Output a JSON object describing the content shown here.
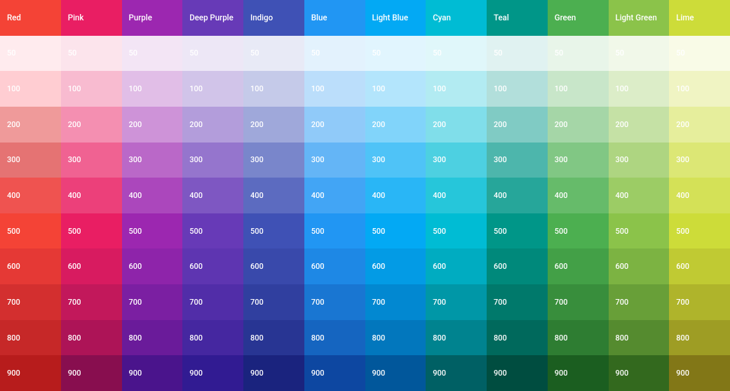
{
  "colors": [
    {
      "name": "Red",
      "swatches": {
        "header": "#f44336",
        "50": "#ffebee",
        "100": "#ffcdd2",
        "200": "#ef9a9a",
        "300": "#e57373",
        "400": "#ef5350",
        "500": "#f44336",
        "600": "#e53935",
        "700": "#d32f2f",
        "800": "#c62828",
        "900": "#b71c1c"
      }
    },
    {
      "name": "Pink",
      "swatches": {
        "header": "#e91e63",
        "50": "#fce4ec",
        "100": "#f8bbd0",
        "200": "#f48fb1",
        "300": "#f06292",
        "400": "#ec407a",
        "500": "#e91e63",
        "600": "#d81b60",
        "700": "#c2185b",
        "800": "#ad1457",
        "900": "#880e4f"
      }
    },
    {
      "name": "Purple",
      "swatches": {
        "header": "#9c27b0",
        "50": "#f3e5f5",
        "100": "#e1bee7",
        "200": "#ce93d8",
        "300": "#ba68c8",
        "400": "#ab47bc",
        "500": "#9c27b0",
        "600": "#8e24aa",
        "700": "#7b1fa2",
        "800": "#6a1b9a",
        "900": "#4a148c"
      }
    },
    {
      "name": "Deep Purple",
      "swatches": {
        "header": "#673ab7",
        "50": "#ede7f6",
        "100": "#d1c4e9",
        "200": "#b39ddb",
        "300": "#9575cd",
        "400": "#7e57c2",
        "500": "#673ab7",
        "600": "#5e35b1",
        "700": "#512da8",
        "800": "#4527a0",
        "900": "#311b92"
      }
    },
    {
      "name": "Indigo",
      "swatches": {
        "header": "#3f51b5",
        "50": "#e8eaf6",
        "100": "#c5cae9",
        "200": "#9fa8da",
        "300": "#7986cb",
        "400": "#5c6bc0",
        "500": "#3f51b5",
        "600": "#3949ab",
        "700": "#303f9f",
        "800": "#283593",
        "900": "#1a237e"
      }
    },
    {
      "name": "Blue",
      "swatches": {
        "header": "#2196f3",
        "50": "#e3f2fd",
        "100": "#bbdefb",
        "200": "#90caf9",
        "300": "#64b5f6",
        "400": "#42a5f5",
        "500": "#2196f3",
        "600": "#1e88e5",
        "700": "#1976d2",
        "800": "#1565c0",
        "900": "#0d47a1"
      }
    },
    {
      "name": "Light Blue",
      "swatches": {
        "header": "#03a9f4",
        "50": "#e1f5fe",
        "100": "#b3e5fc",
        "200": "#81d4fa",
        "300": "#4fc3f7",
        "400": "#29b6f6",
        "500": "#03a9f4",
        "600": "#039be5",
        "700": "#0288d1",
        "800": "#0277bd",
        "900": "#01579b"
      }
    },
    {
      "name": "Cyan",
      "swatches": {
        "header": "#00bcd4",
        "50": "#e0f7fa",
        "100": "#b2ebf2",
        "200": "#80deea",
        "300": "#4dd0e1",
        "400": "#26c6da",
        "500": "#00bcd4",
        "600": "#00acc1",
        "700": "#0097a7",
        "800": "#00838f",
        "900": "#006064"
      }
    },
    {
      "name": "Teal",
      "swatches": {
        "header": "#009688",
        "50": "#e0f2f1",
        "100": "#b2dfdb",
        "200": "#80cbc4",
        "300": "#4db6ac",
        "400": "#26a69a",
        "500": "#009688",
        "600": "#00897b",
        "700": "#00796b",
        "800": "#00695c",
        "900": "#004d40"
      }
    },
    {
      "name": "Green",
      "swatches": {
        "header": "#4caf50",
        "50": "#e8f5e9",
        "100": "#c8e6c9",
        "200": "#a5d6a7",
        "300": "#81c784",
        "400": "#66bb6a",
        "500": "#4caf50",
        "600": "#43a047",
        "700": "#388e3c",
        "800": "#2e7d32",
        "900": "#1b5e20"
      }
    },
    {
      "name": "Light Green",
      "swatches": {
        "header": "#8bc34a",
        "50": "#f1f8e9",
        "100": "#dcedc8",
        "200": "#c5e1a5",
        "300": "#aed581",
        "400": "#9ccc65",
        "500": "#8bc34a",
        "600": "#7cb342",
        "700": "#689f38",
        "800": "#558b2f",
        "900": "#33691e"
      }
    },
    {
      "name": "Lime",
      "swatches": {
        "header": "#cddc39",
        "50": "#f9fbe7",
        "100": "#f0f4c3",
        "200": "#e6ee9c",
        "300": "#dce775",
        "400": "#d4e157",
        "500": "#cddc39",
        "600": "#c0ca33",
        "700": "#afb42b",
        "800": "#9e9d24",
        "900": "#827717"
      }
    }
  ],
  "shades": [
    "50",
    "100",
    "200",
    "300",
    "400",
    "500",
    "600",
    "700",
    "800",
    "900"
  ]
}
